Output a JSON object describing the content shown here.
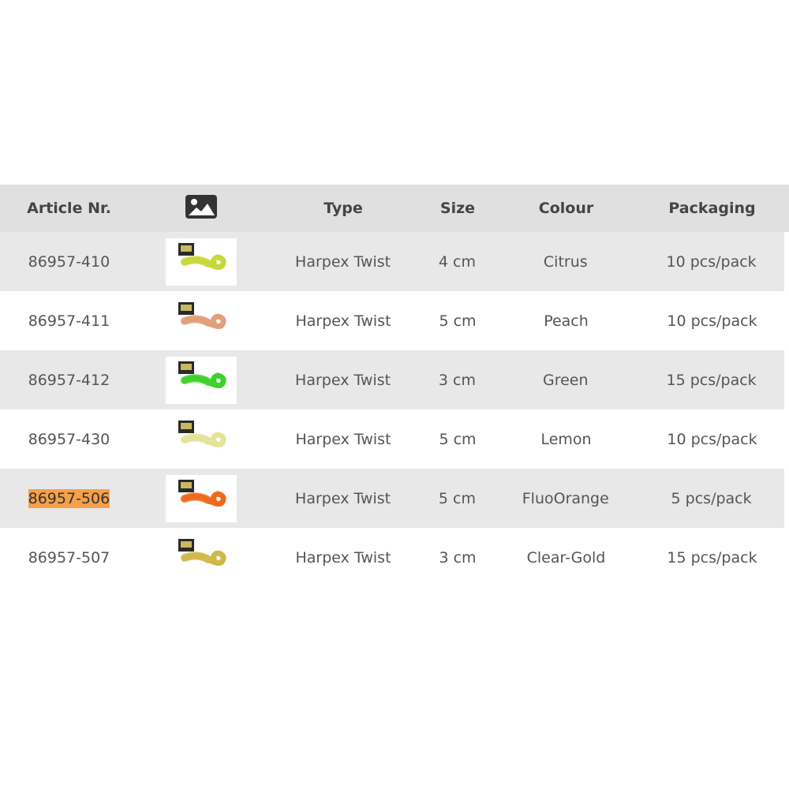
{
  "table": {
    "headers": {
      "article": "Article Nr.",
      "image_icon": "image-icon",
      "type": "Type",
      "size": "Size",
      "colour": "Colour",
      "packaging": "Packaging"
    },
    "rows": [
      {
        "article": "86957-410",
        "type": "Harpex Twist",
        "size": "4 cm",
        "colour": "Citrus",
        "packaging": "10 pcs/pack",
        "lure_color": "#c8d838",
        "highlighted": false
      },
      {
        "article": "86957-411",
        "type": "Harpex Twist",
        "size": "5 cm",
        "colour": "Peach",
        "packaging": "10 pcs/pack",
        "lure_color": "#e0a07a",
        "highlighted": false
      },
      {
        "article": "86957-412",
        "type": "Harpex Twist",
        "size": "3 cm",
        "colour": "Green",
        "packaging": "15 pcs/pack",
        "lure_color": "#3fd12a",
        "highlighted": false
      },
      {
        "article": "86957-430",
        "type": "Harpex Twist",
        "size": "5 cm",
        "colour": "Lemon",
        "packaging": "10 pcs/pack",
        "lure_color": "#e3e39a",
        "highlighted": false
      },
      {
        "article": "86957-506",
        "type": "Harpex Twist",
        "size": "5 cm",
        "colour": "FluoOrange",
        "packaging": "5 pcs/pack",
        "lure_color": "#f06a1c",
        "highlighted": true
      },
      {
        "article": "86957-507",
        "type": "Harpex Twist",
        "size": "3 cm",
        "colour": "Clear-Gold",
        "packaging": "15 pcs/pack",
        "lure_color": "#d1b84a",
        "highlighted": false
      }
    ]
  },
  "colors": {
    "header_bg": "#e0e0e0",
    "shaded_row_bg": "#e8e8e8",
    "highlight": "#f5a04a"
  }
}
